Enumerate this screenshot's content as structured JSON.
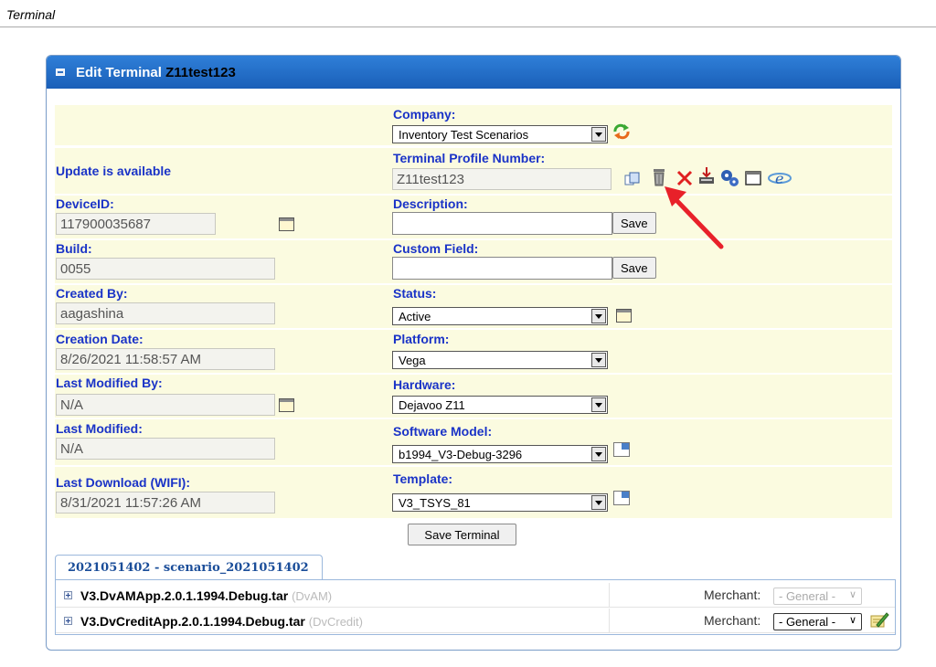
{
  "page": {
    "title": "Terminal"
  },
  "panel": {
    "header_label": "Edit Terminal",
    "terminal_name": "Z11test123"
  },
  "fields": {
    "company": {
      "label": "Company:",
      "value": "Inventory Test Scenarios"
    },
    "update_notice": "Update is available",
    "profile_number": {
      "label": "Terminal Profile Number:",
      "value": "Z11test123"
    },
    "device_id": {
      "label": "DeviceID:",
      "value": "117900035687"
    },
    "description": {
      "label": "Description:",
      "value": "",
      "save_label": "Save"
    },
    "build": {
      "label": "Build:",
      "value": "0055"
    },
    "custom_field": {
      "label": "Custom Field:",
      "value": "",
      "save_label": "Save"
    },
    "created_by": {
      "label": "Created By:",
      "value": "aagashina"
    },
    "status": {
      "label": "Status:",
      "value": "Active"
    },
    "creation_date": {
      "label": "Creation Date:",
      "value": "8/26/2021 11:58:57 AM"
    },
    "platform": {
      "label": "Platform:",
      "value": "Vega"
    },
    "last_modified_by": {
      "label": "Last Modified By:",
      "value": "N/A"
    },
    "hardware": {
      "label": "Hardware:",
      "value": "Dejavoo Z11"
    },
    "last_modified": {
      "label": "Last Modified:",
      "value": "N/A"
    },
    "software_model": {
      "label": "Software Model:",
      "value": "b1994_V3-Debug-3296"
    },
    "last_download": {
      "label": "Last Download (WIFI):",
      "value": "8/31/2021 11:57:26 AM"
    },
    "template": {
      "label": "Template:",
      "value": "V3_TSYS_81"
    }
  },
  "save_terminal_label": "Save Terminal",
  "tab": {
    "label": "2021051402 - scenario_2021051402"
  },
  "apps": [
    {
      "name": "V3.DvAMApp.2.0.1.1994.Debug.tar",
      "type": "(DvAM)",
      "merchant_label": "Merchant:",
      "merchant_value": "- General -",
      "enabled": false
    },
    {
      "name": "V3.DvCreditApp.2.0.1.1994.Debug.tar",
      "type": "(DvCredit)",
      "merchant_label": "Merchant:",
      "merchant_value": "- General -",
      "enabled": true
    }
  ],
  "colors": {
    "header": "#1a5fb8",
    "label": "#1a33c7",
    "row_bg": "#fbfbe0",
    "annotation_arrow": "#e8212a"
  },
  "icons": {
    "toolbar": [
      "copy-icon",
      "trash-icon",
      "delete-x-icon",
      "download-icon",
      "settings-gears-icon",
      "window-icon",
      "ie-browser-icon"
    ],
    "refresh": "refresh-icon",
    "calendar": "calendar-icon",
    "popout": "popout-icon",
    "edit": "edit-pencil-icon"
  }
}
